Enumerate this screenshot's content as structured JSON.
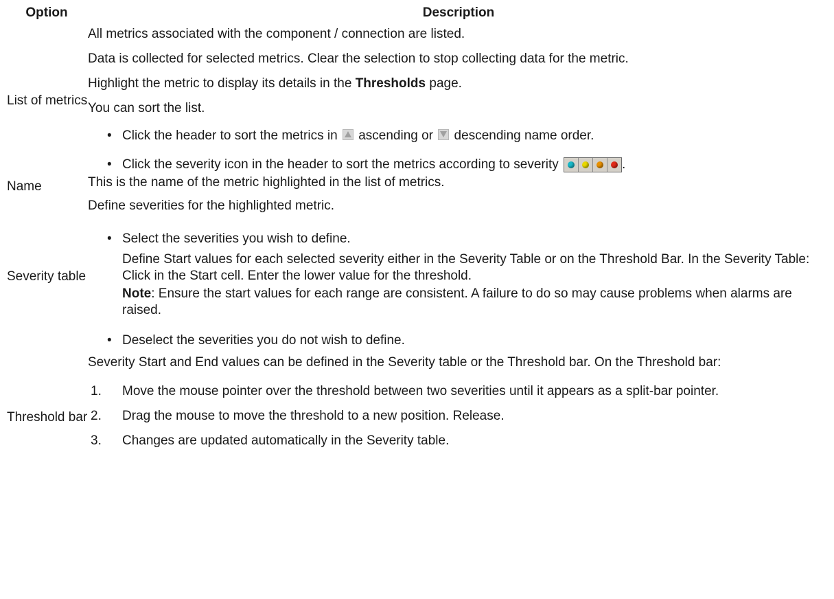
{
  "headers": {
    "option": "Option",
    "description": "Description"
  },
  "rows": {
    "list_of_metrics": {
      "option": "List of metrics",
      "p1": "All metrics associated with the component / connection are listed.",
      "p2": "Data is collected for selected metrics. Clear the selection to stop collecting data for the metric.",
      "p3_pre": "Highlight the metric to display its details in the ",
      "p3_bold": "Thresholds",
      "p3_post": " page.",
      "p4": "You can sort the list.",
      "b1_pre": "Click the header to sort the metrics in ",
      "b1_mid": " ascending or ",
      "b1_post": " descending name order.",
      "b2": "Click the severity icon in the header to sort the metrics according to severity ",
      "b2_end": "."
    },
    "name": {
      "option": "Name",
      "p1": "This is the name of the metric highlighted in the list of metrics."
    },
    "severity_table": {
      "option": "Severity table",
      "p1": "Define severities for the highlighted metric.",
      "b1": "Select the severities you wish to define.",
      "b1_detail": "Define Start values for each selected severity either in the Severity Table or on the Threshold Bar. In the Severity Table: Click in the Start cell. Enter the lower value for the threshold.",
      "note_bold": "Note",
      "note_text": ": Ensure the start values for each range are consistent. A failure to do so may cause problems when alarms are raised.",
      "b2": "Deselect the severities you do not wish to define."
    },
    "threshold_bar": {
      "option": "Threshold bar",
      "p1": "Severity Start and End values can be defined in the Severity table or the Threshold bar. On the Threshold bar:",
      "steps": [
        {
          "num": "1.",
          "text": "Move the mouse pointer over the threshold between two severities until it appears as a split-bar pointer."
        },
        {
          "num": "2.",
          "text": "Drag the mouse to move the threshold to a new position. Release."
        },
        {
          "num": "3.",
          "text": "Changes are updated automatically in the Severity table."
        }
      ]
    }
  },
  "icons": {
    "ascending": "ascending-sort-icon",
    "descending": "descending-sort-icon",
    "severity": [
      "cyan",
      "yellow",
      "orange",
      "red"
    ]
  },
  "colors": {
    "cyan": "#18b8c8",
    "yellow": "#e8d800",
    "orange": "#e89000",
    "red": "#e02818"
  }
}
